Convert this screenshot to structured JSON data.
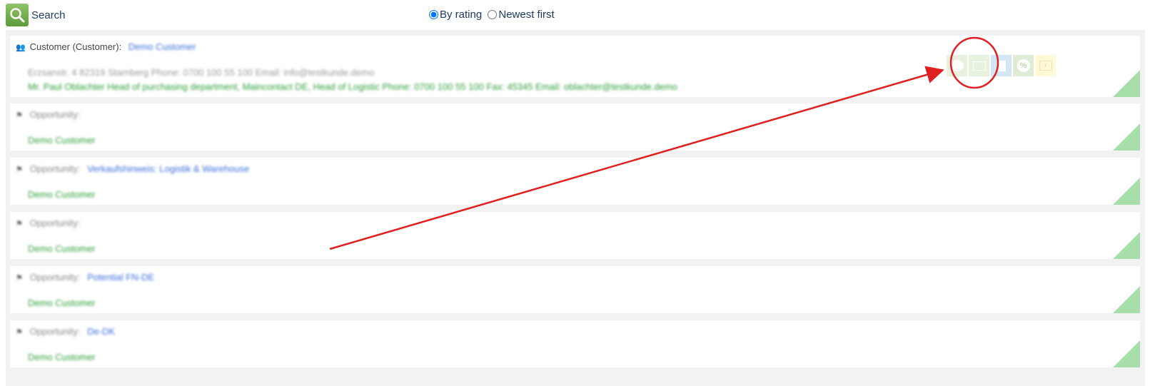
{
  "toolbar": {
    "search_label": "Search",
    "sort_options": [
      {
        "label": "By rating",
        "checked": true
      },
      {
        "label": "Newest first",
        "checked": false
      }
    ]
  },
  "results": [
    {
      "type_label": "Customer (Customer):",
      "type_icon": "users-icon",
      "link": "Demo Customer",
      "address_line": "Erzsanstr. 4 82319 Starnberg Phone: 0700 100 55 100  Email: info@testkunde.demo",
      "contact_line": "Mr. Paul Oblachter  Head of purchasing department, Maincontact DE, Head of Logistic Phone: 0700 100 55 100 Fax: 45345 Email: oblachter@testkunde.demo",
      "actions": [
        "comment-icon",
        "mail-icon",
        "pdf-icon",
        "percent-icon",
        "calendar-icon"
      ],
      "calendar_text": "7",
      "percent_text": "%"
    },
    {
      "type_label": "Opportunity:",
      "type_icon": "opportunity-icon",
      "link": "",
      "customer": "Demo Customer"
    },
    {
      "type_label": "Opportunity:",
      "type_icon": "opportunity-icon",
      "link": "Verkaufshinweis: Logistik & Warehouse",
      "customer": "Demo Customer"
    },
    {
      "type_label": "Opportunity:",
      "type_icon": "opportunity-icon",
      "link": "",
      "customer": "Demo Customer"
    },
    {
      "type_label": "Opportunity:",
      "type_icon": "opportunity-icon",
      "link": "Potential FN-DE",
      "customer": "Demo Customer"
    },
    {
      "type_label": "Opportunity:",
      "type_icon": "opportunity-icon",
      "link": "De-DK",
      "customer": "Demo Customer"
    }
  ],
  "colors": {
    "link": "#3a6fd8",
    "green_text": "#2e9e38",
    "corner_marker": "#a6dfaa",
    "annotation": "#e02020"
  }
}
